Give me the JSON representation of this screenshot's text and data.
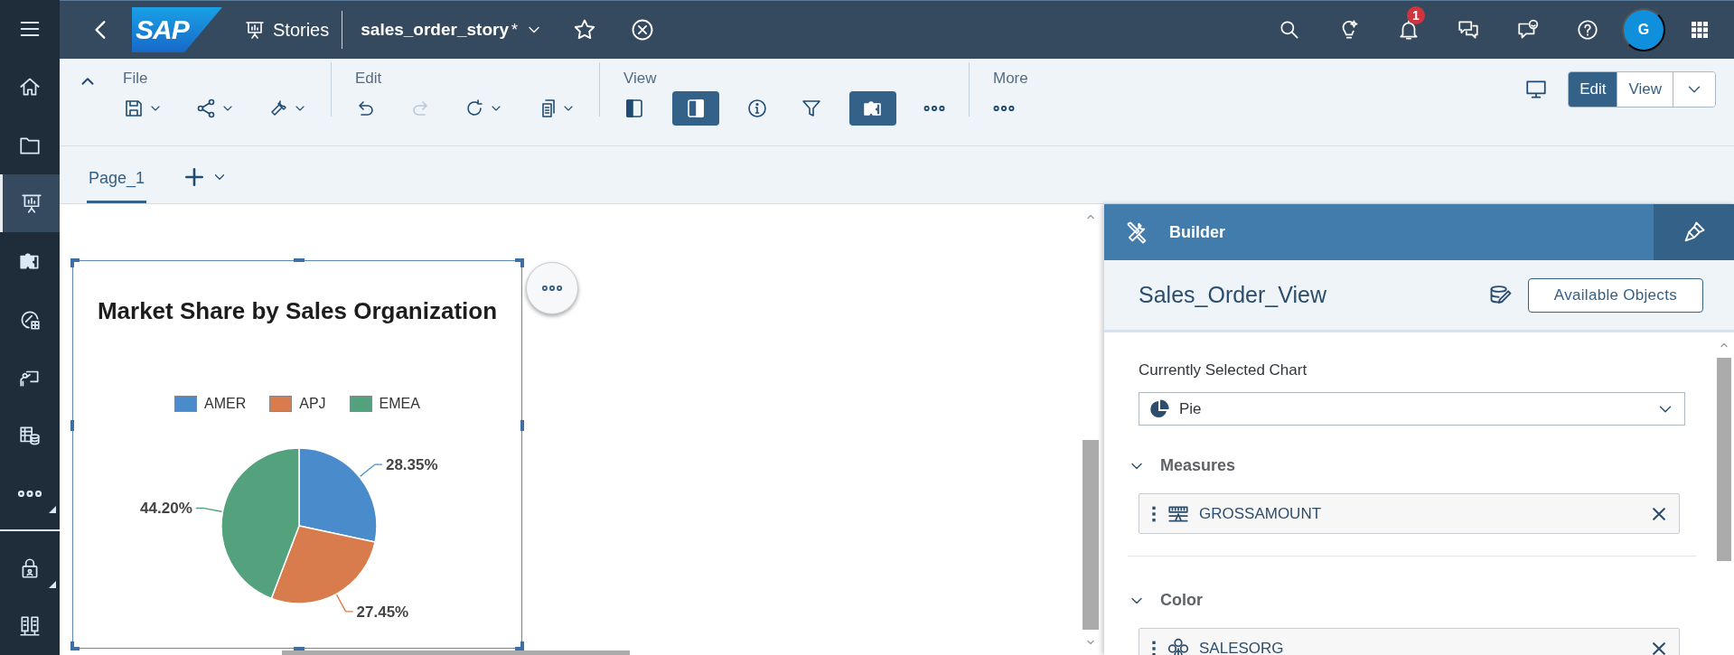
{
  "shell_bar": {
    "logo": "SAP",
    "app": "Stories",
    "title": "sales_order_story",
    "modified_mark": "*",
    "notification_badge": "1",
    "avatar": "G"
  },
  "sidebar": {
    "items": [
      {
        "kind": "home",
        "selected": false,
        "submenu": false
      },
      {
        "kind": "files",
        "selected": false,
        "submenu": false
      },
      {
        "kind": "stories",
        "selected": true,
        "submenu": false
      },
      {
        "kind": "modeler",
        "selected": false,
        "submenu": false
      },
      {
        "kind": "gauge",
        "selected": false,
        "submenu": false
      },
      {
        "kind": "presenter",
        "selected": false,
        "submenu": false
      },
      {
        "kind": "data",
        "selected": false,
        "submenu": false
      },
      {
        "kind": "more",
        "selected": false,
        "submenu": true
      }
    ],
    "bottom_items": [
      {
        "kind": "security",
        "selected": false,
        "submenu": true
      },
      {
        "kind": "system",
        "selected": false,
        "submenu": false
      }
    ]
  },
  "toolbar": {
    "groups": [
      {
        "label": "File",
        "items": [
          {
            "kind": "save",
            "menu": true,
            "on": false,
            "disabled": false
          },
          {
            "kind": "share",
            "menu": true,
            "on": false,
            "disabled": false
          },
          {
            "kind": "tools",
            "menu": true,
            "on": false,
            "disabled": false
          }
        ]
      },
      {
        "label": "Edit",
        "items": [
          {
            "kind": "undo",
            "menu": false,
            "on": false,
            "disabled": false
          },
          {
            "kind": "redo",
            "menu": false,
            "on": false,
            "disabled": true
          },
          {
            "kind": "refresh",
            "menu": true,
            "on": false,
            "disabled": false
          },
          {
            "kind": "copy",
            "menu": true,
            "on": false,
            "disabled": false
          }
        ]
      },
      {
        "label": "View",
        "items": [
          {
            "kind": "leftpanel",
            "menu": false,
            "on": false,
            "disabled": false
          },
          {
            "kind": "rightpanel",
            "menu": false,
            "on": true,
            "disabled": false
          },
          {
            "kind": "info",
            "menu": false,
            "on": false,
            "disabled": false
          },
          {
            "kind": "filter",
            "menu": false,
            "on": false,
            "disabled": false
          },
          {
            "kind": "puzzle",
            "menu": false,
            "on": true,
            "disabled": false
          },
          {
            "kind": "more",
            "menu": false,
            "on": false,
            "disabled": false
          }
        ]
      },
      {
        "label": "More",
        "items": [
          {
            "kind": "more",
            "menu": false,
            "on": false,
            "disabled": false
          }
        ]
      }
    ],
    "mode_switch": [
      {
        "label": "Edit",
        "selected": true
      },
      {
        "label": "View",
        "selected": false
      }
    ]
  },
  "tabs": [
    {
      "label": "Page_1",
      "selected": true
    }
  ],
  "chart_widget": {
    "title": "Market Share by Sales Organization",
    "legend": [
      {
        "color": "#4a8bcb"
      },
      {
        "color": "#d97c4d"
      },
      {
        "color": "#53a27d"
      }
    ],
    "chart_data": {
      "type": "pie",
      "categories": [
        "AMER",
        "APJ",
        "EMEA"
      ],
      "values": [
        28.35,
        27.45,
        44.2
      ],
      "value_labels": [
        "28.35%",
        "27.45%",
        "44.20%"
      ]
    }
  },
  "builder": {
    "title": "Builder",
    "model": "Sales_Order_View",
    "available_button": "Available Objects",
    "chart_type_label": "Currently Selected Chart",
    "chart_type": "Pie",
    "sections": [
      {
        "title": "Measures",
        "expanded": true,
        "fields": [
          {
            "name": "GROSSAMOUNT",
            "kind": "measure"
          }
        ]
      },
      {
        "title": "Color",
        "expanded": true,
        "fields": [
          {
            "name": "SALESORG",
            "kind": "dimension"
          }
        ]
      }
    ]
  }
}
